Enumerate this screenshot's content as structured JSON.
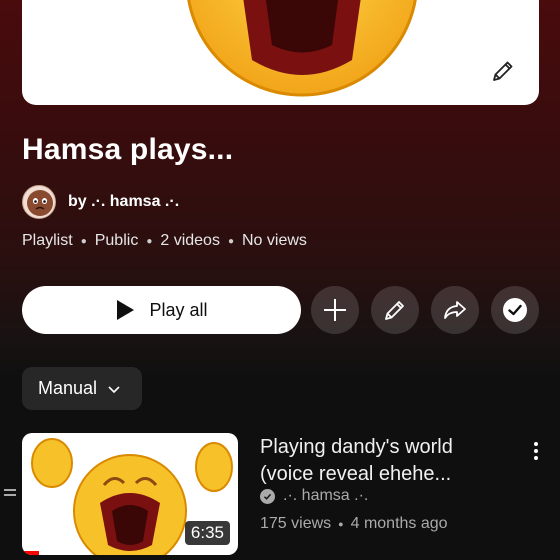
{
  "playlist": {
    "title": "Hamsa plays...",
    "owner_line": "by .·. hamsa .·.",
    "meta": {
      "type": "Playlist",
      "visibility": "Public",
      "video_count": "2 videos",
      "views": "No views"
    }
  },
  "actions": {
    "play_all_label": "Play all",
    "icons": [
      "play-icon",
      "plus-icon",
      "pencil-icon",
      "share-icon",
      "check-icon"
    ]
  },
  "sort": {
    "selected": "Manual"
  },
  "videos": [
    {
      "title": "Playing dandy's world (voice reveal ehehe...",
      "channel": ".·. hamsa .·.",
      "views": "175 views",
      "age": "4 months ago",
      "duration": "6:35",
      "progress_fraction": 0.08
    }
  ],
  "colors": {
    "accent_red": "#ff0000",
    "background": "#0f0f0f",
    "header_gradient_top": "#4a0b0d",
    "chip_background": "#272727"
  }
}
